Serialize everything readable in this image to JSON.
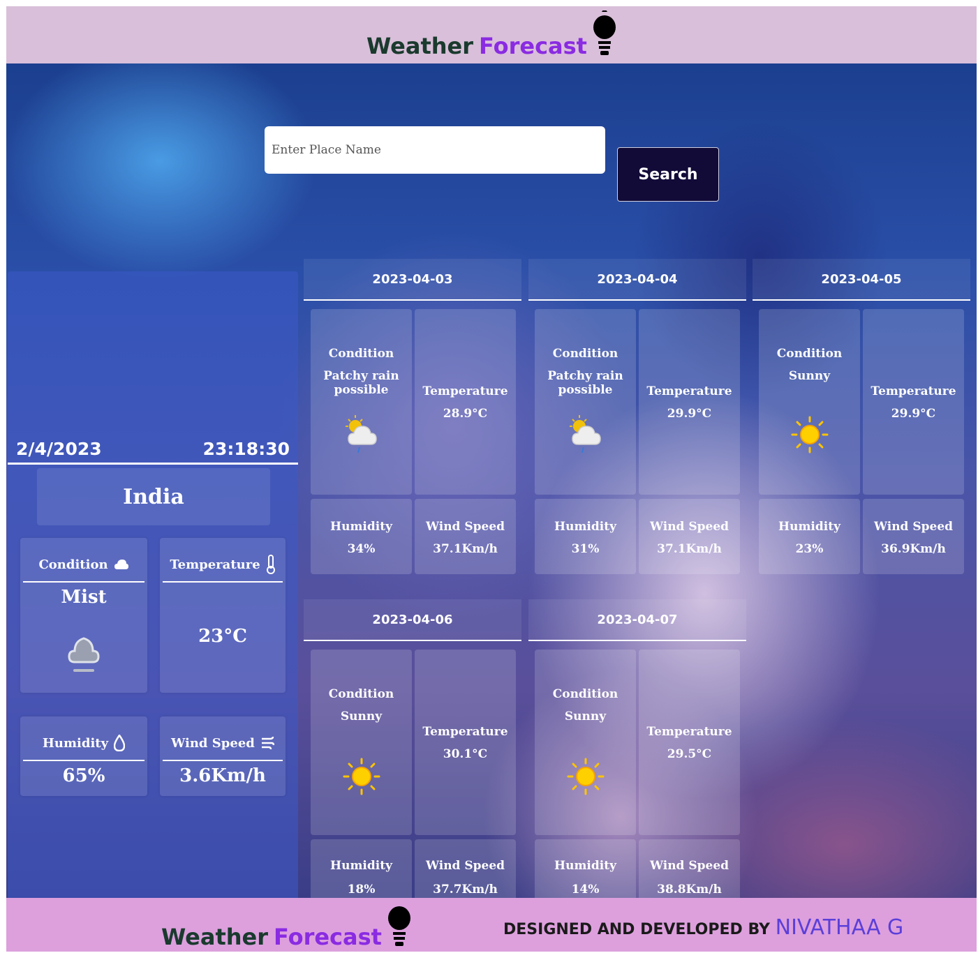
{
  "header": {
    "brand_part1": "Weather",
    "brand_part2": "Forecast"
  },
  "search": {
    "placeholder": "Enter Place Name",
    "button_label": "Search"
  },
  "current": {
    "date": "2/4/2023",
    "time": "23:18:30",
    "place": "India",
    "condition_label": "Condition",
    "condition_value": "Mist",
    "temperature_label": "Temperature",
    "temperature_value": "23°C",
    "humidity_label": "Humidity",
    "humidity_value": "65%",
    "wind_label": "Wind Speed",
    "wind_value": "3.6Km/h"
  },
  "forecast_labels": {
    "condition": "Condition",
    "temperature": "Temperature",
    "humidity": "Humidity",
    "wind": "Wind Speed"
  },
  "forecast": [
    {
      "date": "2023-04-03",
      "condition": "Patchy rain possible",
      "icon": "partly-cloudy-rain-icon",
      "temperature": "28.9°C",
      "humidity": "34%",
      "wind": "37.1Km/h"
    },
    {
      "date": "2023-04-04",
      "condition": "Patchy rain possible",
      "icon": "partly-cloudy-rain-icon",
      "temperature": "29.9°C",
      "humidity": "31%",
      "wind": "37.1Km/h"
    },
    {
      "date": "2023-04-05",
      "condition": "Sunny",
      "icon": "sun-icon",
      "temperature": "29.9°C",
      "humidity": "23%",
      "wind": "36.9Km/h"
    },
    {
      "date": "2023-04-06",
      "condition": "Sunny",
      "icon": "sun-icon",
      "temperature": "30.1°C",
      "humidity": "18%",
      "wind": "37.7Km/h"
    },
    {
      "date": "2023-04-07",
      "condition": "Sunny",
      "icon": "sun-icon",
      "temperature": "29.5°C",
      "humidity": "14%",
      "wind": "38.8Km/h"
    }
  ],
  "footer": {
    "brand_part1": "Weather",
    "brand_part2": "Forecast",
    "credit_prefix": "DESIGNED AND DEVELOPED BY",
    "credit_name": "NIVATHAA G"
  },
  "colors": {
    "header_bg": "#d9bfd9",
    "footer_bg": "#dda0dd",
    "brand_accent": "#8a2be2",
    "search_button": "#120b38"
  }
}
